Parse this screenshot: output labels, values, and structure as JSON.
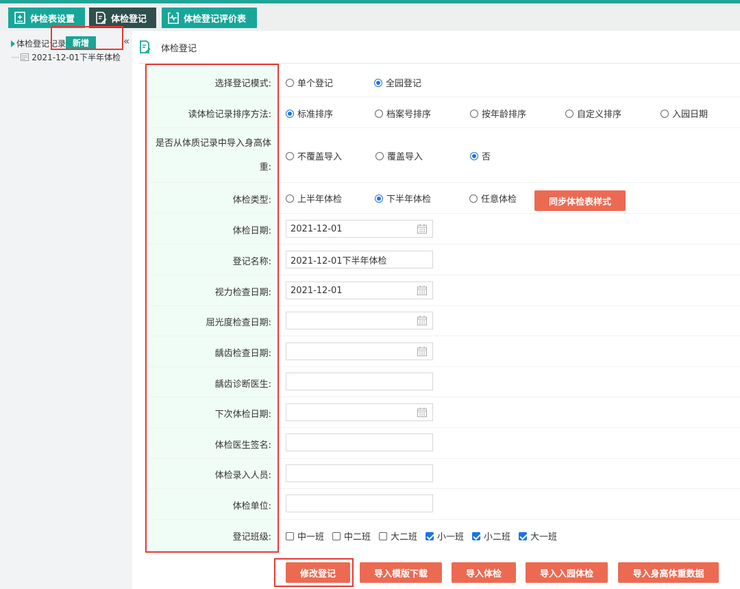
{
  "tabs": [
    {
      "label": "体检表设置",
      "icon": "clipboard-plus-icon"
    },
    {
      "label": "体检登记",
      "icon": "document-edit-icon"
    },
    {
      "label": "体检登记评价表",
      "icon": "heart-clipboard-icon"
    }
  ],
  "tree": {
    "root_label": "体检登记记录",
    "add_label": "新增",
    "collapse_glyph": "«",
    "child_label": "2021-12-01下半年体检"
  },
  "header": {
    "title": "体检登记"
  },
  "form": {
    "mode": {
      "label": "选择登记模式:",
      "options": [
        "单个登记",
        "全园登记"
      ],
      "selected": "全园登记"
    },
    "sort": {
      "label": "读体检记录排序方法:",
      "options": [
        "标准排序",
        "档案号排序",
        "按年龄排序",
        "自定义排序",
        "入园日期"
      ],
      "selected": "标准排序"
    },
    "import_hw": {
      "label": "是否从体质记录中导入身高体重:",
      "options": [
        "不覆盖导入",
        "覆盖导入",
        "否"
      ],
      "selected": "否"
    },
    "exam_type": {
      "label": "体检类型:",
      "options": [
        "上半年体检",
        "下半年体检",
        "任意体检"
      ],
      "selected": "下半年体检",
      "sync_button": "同步体检表样式"
    },
    "exam_date": {
      "label": "体检日期:",
      "value": "2021-12-01"
    },
    "reg_name": {
      "label": "登记名称:",
      "value": "2021-12-01下半年体检"
    },
    "vision_date": {
      "label": "视力检查日期:",
      "value": "2021-12-01"
    },
    "refraction_date": {
      "label": "屈光度检查日期:",
      "value": ""
    },
    "caries_date": {
      "label": "龋齿检查日期:",
      "value": ""
    },
    "caries_doctor": {
      "label": "龋齿诊断医生:",
      "value": ""
    },
    "next_date": {
      "label": "下次体检日期:",
      "value": ""
    },
    "doctor_sign": {
      "label": "体检医生签名:",
      "value": ""
    },
    "entry_person": {
      "label": "体检录入人员:",
      "value": ""
    },
    "unit": {
      "label": "体检单位:",
      "value": ""
    },
    "classes": {
      "label": "登记班级:",
      "items": [
        {
          "name": "中一班",
          "checked": false
        },
        {
          "name": "中二班",
          "checked": false
        },
        {
          "name": "大二班",
          "checked": false
        },
        {
          "name": "小一班",
          "checked": true
        },
        {
          "name": "小二班",
          "checked": true
        },
        {
          "name": "大一班",
          "checked": true
        }
      ]
    }
  },
  "actions": [
    "修改登记",
    "导入模版下载",
    "导入体检",
    "导入入园体检",
    "导入身高体重数据"
  ],
  "colors": {
    "teal": "#17a79a",
    "dark_tab": "#2f4f4c",
    "orange": "#ec6a52",
    "highlight_red": "#e53935",
    "label_bg": "#f0fcf6",
    "radio_blue": "#1a73e8"
  }
}
